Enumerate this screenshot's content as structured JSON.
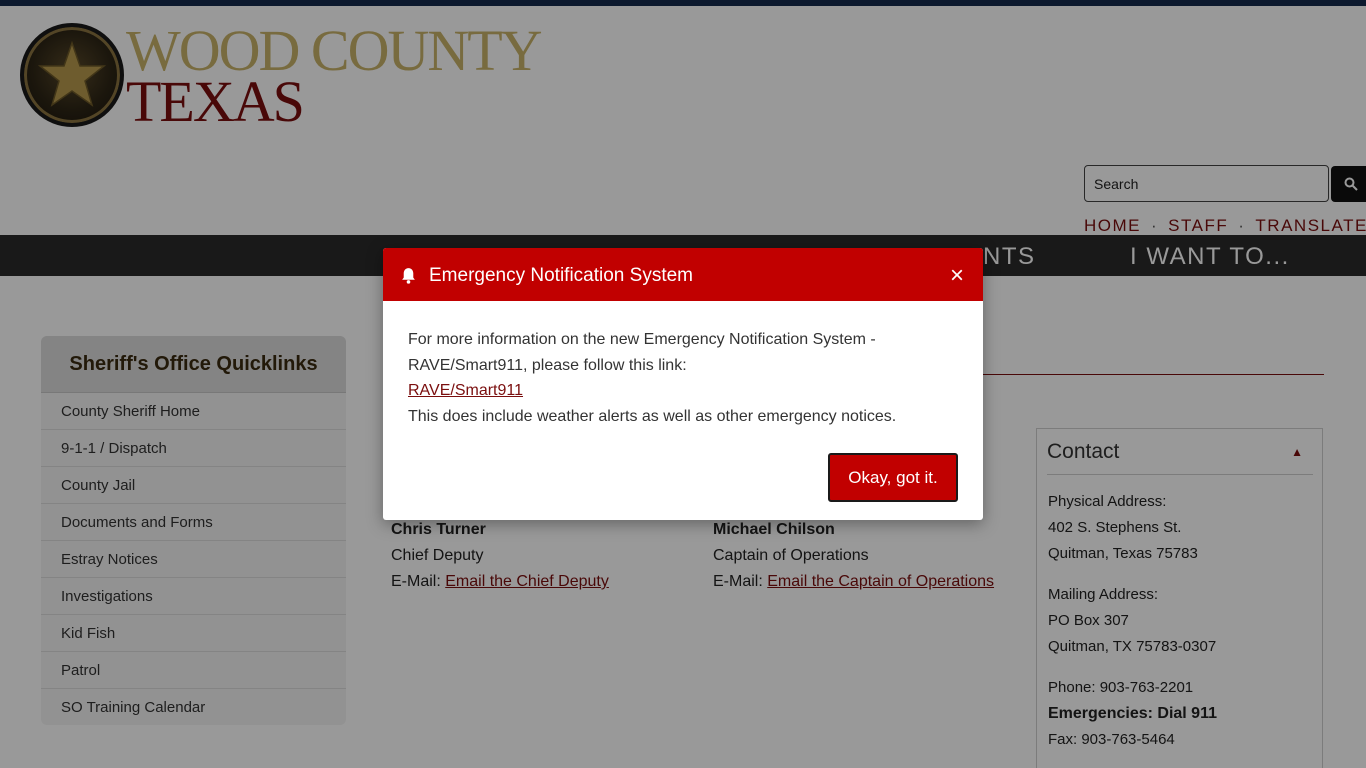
{
  "header": {
    "logo_line1": "WOOD COUNTY",
    "logo_line2": "TEXAS",
    "search_placeholder": "Search",
    "util_nav": [
      "HOME",
      "STAFF",
      "TRANSLATE"
    ],
    "util_sep": "·"
  },
  "main_nav": {
    "items": [
      "NTS",
      "I WANT TO..."
    ]
  },
  "sidebar": {
    "title": "Sheriff's Office Quicklinks",
    "items": [
      "County Sheriff Home",
      "9-1-1 / Dispatch",
      "County Jail",
      "Documents and Forms",
      "Estray Notices",
      "Investigations",
      "Kid Fish",
      "Patrol",
      "SO Training Calendar"
    ]
  },
  "staff": [
    {
      "name": "Chris Turner",
      "role": "Chief Deputy",
      "email_prefix": "E-Mail: ",
      "email_link": "Email the Chief Deputy"
    },
    {
      "name": "Michael Chilson",
      "role": "Captain of Operations",
      "email_prefix": "E-Mail: ",
      "email_link": "Email the Captain of Operations"
    }
  ],
  "contact": {
    "title": "Contact",
    "caret": "▲",
    "physical_label": "Physical Address:",
    "physical_street": "402 S. Stephens St.",
    "physical_city": "Quitman, Texas 75783",
    "mailing_label": "Mailing Address:",
    "mailing_box": "PO Box 307",
    "mailing_city": "Quitman, TX 75783-0307",
    "phone": "Phone: 903-763-2201",
    "emergencies": "Emergencies:  Dial 911",
    "fax": "Fax: 903-763-5464"
  },
  "modal": {
    "title": "Emergency Notification System",
    "close": "×",
    "text1": "For more information on the new Emergency Notification System - RAVE/Smart911, please follow this link:",
    "link": "RAVE/Smart911",
    "text2": "This does include weather alerts as well as other emergency notices.",
    "button": "Okay, got it."
  },
  "colors": {
    "brand_red": "#c10000",
    "maroon": "#7a0e0e",
    "nav_bg": "#2b2b2b",
    "gold": "#c9b36a"
  },
  "icons": [
    "star-seal-icon",
    "search-icon",
    "bell-icon",
    "close-icon",
    "caret-up-icon"
  ]
}
